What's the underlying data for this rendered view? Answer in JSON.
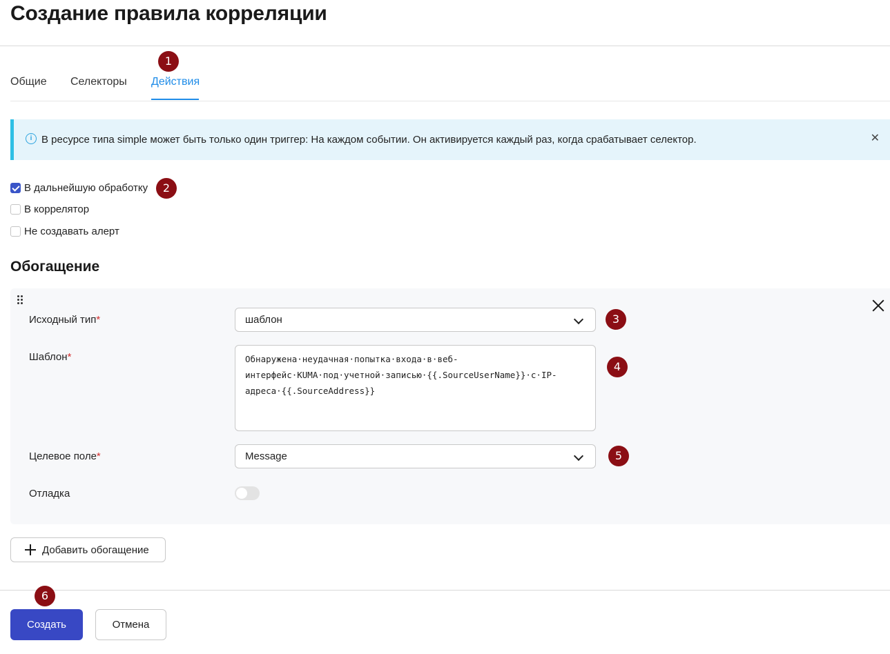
{
  "page": {
    "title": "Создание правила корреляции"
  },
  "tabs": [
    {
      "label": "Общие",
      "active": false
    },
    {
      "label": "Селекторы",
      "active": false
    },
    {
      "label": "Действия",
      "active": true
    }
  ],
  "alert": {
    "text": "В ресурсе типа simple может быть только один триггер: На каждом событии. Он активируется каждый раз, когда срабатывает селектор.",
    "info_icon": "info-icon",
    "close_icon": "close-icon"
  },
  "actions": [
    {
      "label": "В дальнейшую обработку",
      "checked": true
    },
    {
      "label": "В коррелятор",
      "checked": false
    },
    {
      "label": "Не создавать алерт",
      "checked": false
    }
  ],
  "enrichment": {
    "title": "Обогащение",
    "source_type": {
      "label": "Исходный тип",
      "value": "шаблон"
    },
    "template": {
      "label": "Шаблон",
      "value": "Обнаружена·неудачная·попытка·входа·в·веб-интерфейс·KUMA·под·учетной·записью·{{.SourceUserName}}·с·IP-адреса·{{.SourceAddress}}"
    },
    "target_field": {
      "label": "Целевое поле",
      "value": "Message"
    },
    "debug": {
      "label": "Отладка",
      "enabled": false
    },
    "required_mark": "*"
  },
  "buttons": {
    "add_enrichment": "Добавить обогащение",
    "create": "Создать",
    "cancel": "Отмена"
  },
  "badges": [
    "1",
    "2",
    "3",
    "4",
    "5",
    "6"
  ],
  "colors": {
    "accent": "#1f8ce8",
    "primary_button": "#3848c4",
    "badge": "#8b0e14",
    "alert_bg": "#e5f4fb",
    "alert_border": "#2ebfe5"
  }
}
